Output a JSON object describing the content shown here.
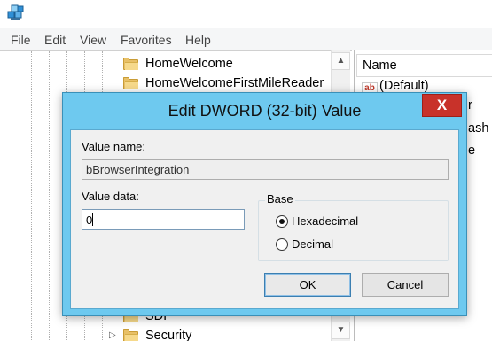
{
  "menubar": {
    "items": [
      "File",
      "Edit",
      "View",
      "Favorites",
      "Help"
    ]
  },
  "tree": {
    "items_top": [
      "HomeWelcome",
      "HomeWelcomeFirstMileReader"
    ],
    "items_bottom": [
      "SDI",
      "Security"
    ]
  },
  "list": {
    "header": "Name",
    "default_row": "(Default)",
    "partial_rows": [
      "r",
      "ash",
      "e"
    ]
  },
  "dialog": {
    "title": "Edit DWORD (32-bit) Value",
    "close_label": "X",
    "value_name_label": "Value name:",
    "value_name": "bBrowserIntegration",
    "value_data_label": "Value data:",
    "value_data": "0",
    "base_label": "Base",
    "options": [
      "Hexadecimal",
      "Decimal"
    ],
    "selected": "Hexadecimal",
    "ok_label": "OK",
    "cancel_label": "Cancel"
  },
  "colors": {
    "dialog_frame": "#6ec9ef",
    "close_button": "#c8322a",
    "folder": "#e8c067"
  }
}
